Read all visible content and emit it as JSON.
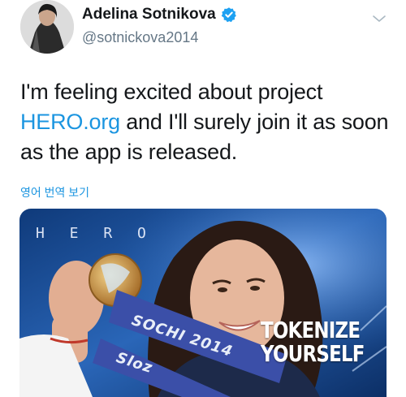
{
  "author": {
    "name": "Adelina Sotnikova",
    "handle": "@sotnickova2014",
    "verified": true
  },
  "tweet": {
    "text_before": "I'm feeling excited about project ",
    "link_text": "HERO.org",
    "text_after": " and I'll surely join it as soon as the app is released.",
    "translate_label": "영어 번역 보기"
  },
  "media": {
    "hero_logo": "H E R O",
    "ribbon_text": "SOCHI 2014",
    "ribbon_text_2": "Sloz",
    "overlay_line1": "TOKENIZE",
    "overlay_line2": "YOURSELF"
  },
  "icons": {
    "verified": "verified-badge-icon",
    "menu": "chevron-down-icon"
  },
  "colors": {
    "link": "#1b95e0",
    "handle": "#657786",
    "verified": "#1da1f2"
  }
}
